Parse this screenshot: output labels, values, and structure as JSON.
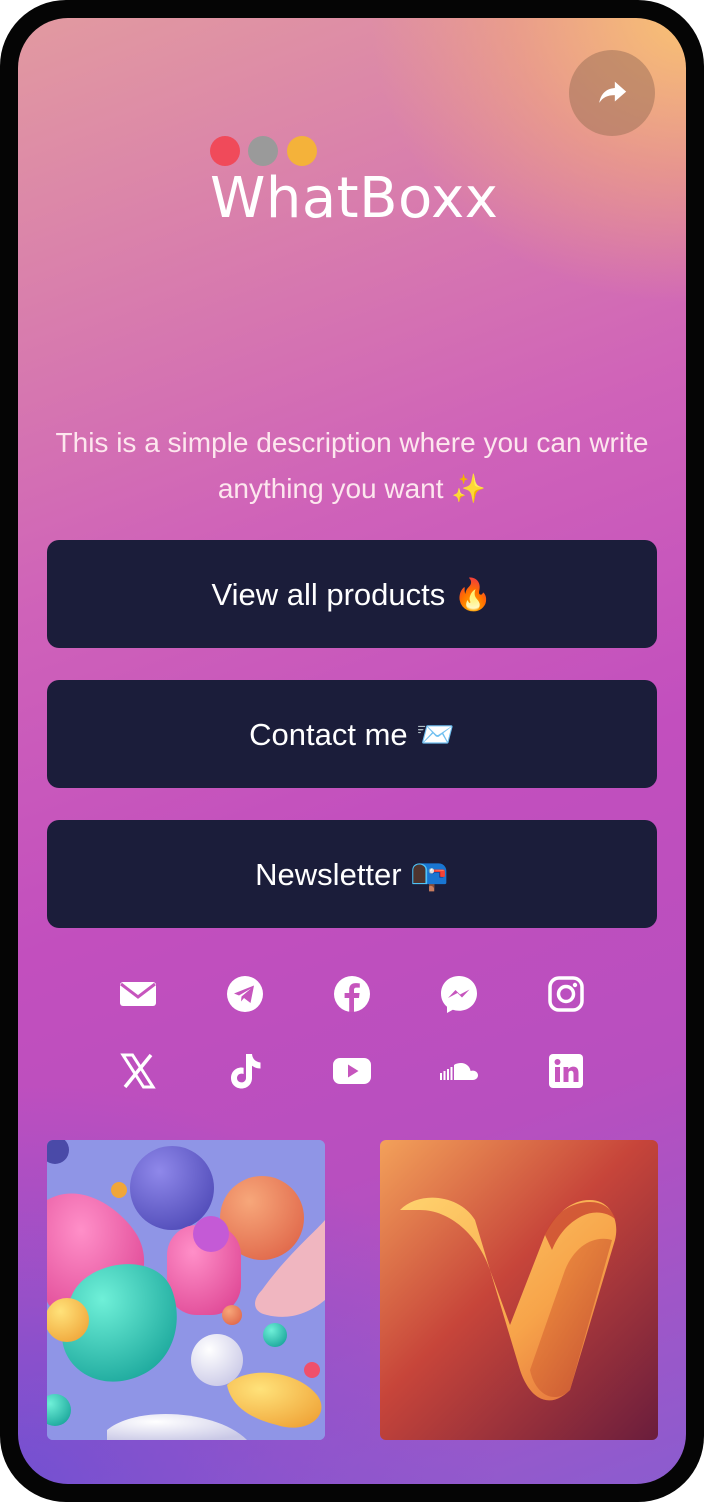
{
  "brand": {
    "name": "WhatBoxx",
    "dot_colors": [
      "#f04a5a",
      "#9a9a9a",
      "#f4b23a"
    ]
  },
  "share": {
    "icon": "share-arrow-icon"
  },
  "description": "This is a simple description where you can write anything you want ✨",
  "links": [
    {
      "label": "View all products 🔥"
    },
    {
      "label": "Contact me 📨"
    },
    {
      "label": "Newsletter 📭"
    }
  ],
  "socials": [
    "email-icon",
    "telegram-icon",
    "facebook-icon",
    "messenger-icon",
    "instagram-icon",
    "x-icon",
    "tiktok-icon",
    "youtube-icon",
    "soundcloud-icon",
    "linkedin-icon"
  ],
  "colors": {
    "button_bg": "#1b1d3a",
    "gradient_top_right": "#f8c473",
    "gradient_middle": "#c24fbe",
    "gradient_bottom_left": "#6e50d2"
  }
}
